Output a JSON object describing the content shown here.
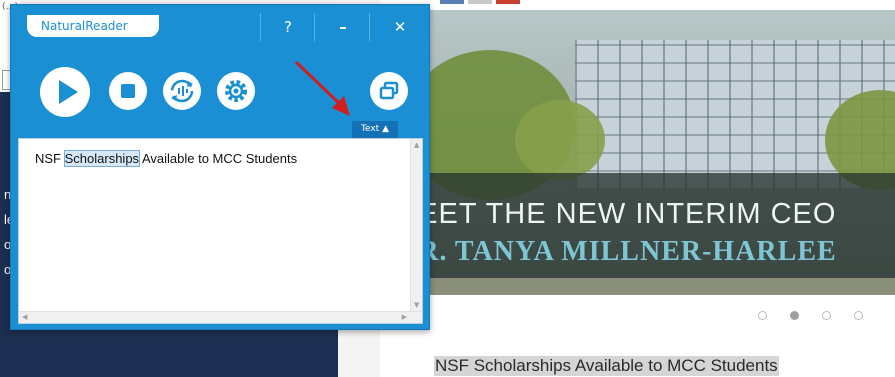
{
  "background_site": {
    "left_fragment": "(…)",
    "left_letters": [
      "n",
      "le",
      "o",
      "o"
    ],
    "hero_line1": "MEET THE NEW INTERIM CEO",
    "hero_line2": "DR. TANYA MILLNER-HARLEE",
    "headline": "NSF Scholarships Available to MCC Students",
    "slider_dots_count": 4,
    "slider_active_index": 1,
    "top_bar_colors": [
      "#5a7fb5",
      "#c9c9c9",
      "#c8422f"
    ]
  },
  "natural_reader": {
    "app_title": "NaturalReader",
    "window_buttons": {
      "help": "?",
      "minimize": "–",
      "close": "✕"
    },
    "controls": [
      {
        "name": "play",
        "icon": "play-icon"
      },
      {
        "name": "stop",
        "icon": "stop-icon"
      },
      {
        "name": "repeat",
        "icon": "repeat-icon"
      },
      {
        "name": "settings",
        "icon": "gear-icon"
      },
      {
        "name": "mini-mode",
        "icon": "window-restore-icon"
      }
    ],
    "text_tab_label": "Text ▲",
    "text_content": {
      "before": "NSF ",
      "highlighted": "Scholarships",
      "after": " Available to MCC Students"
    },
    "colors": {
      "window_blue": "#1a8fd3",
      "tab_blue": "#1571b6",
      "highlight_bg": "#d6e8f7",
      "annotation_arrow": "#d11f1f"
    }
  }
}
